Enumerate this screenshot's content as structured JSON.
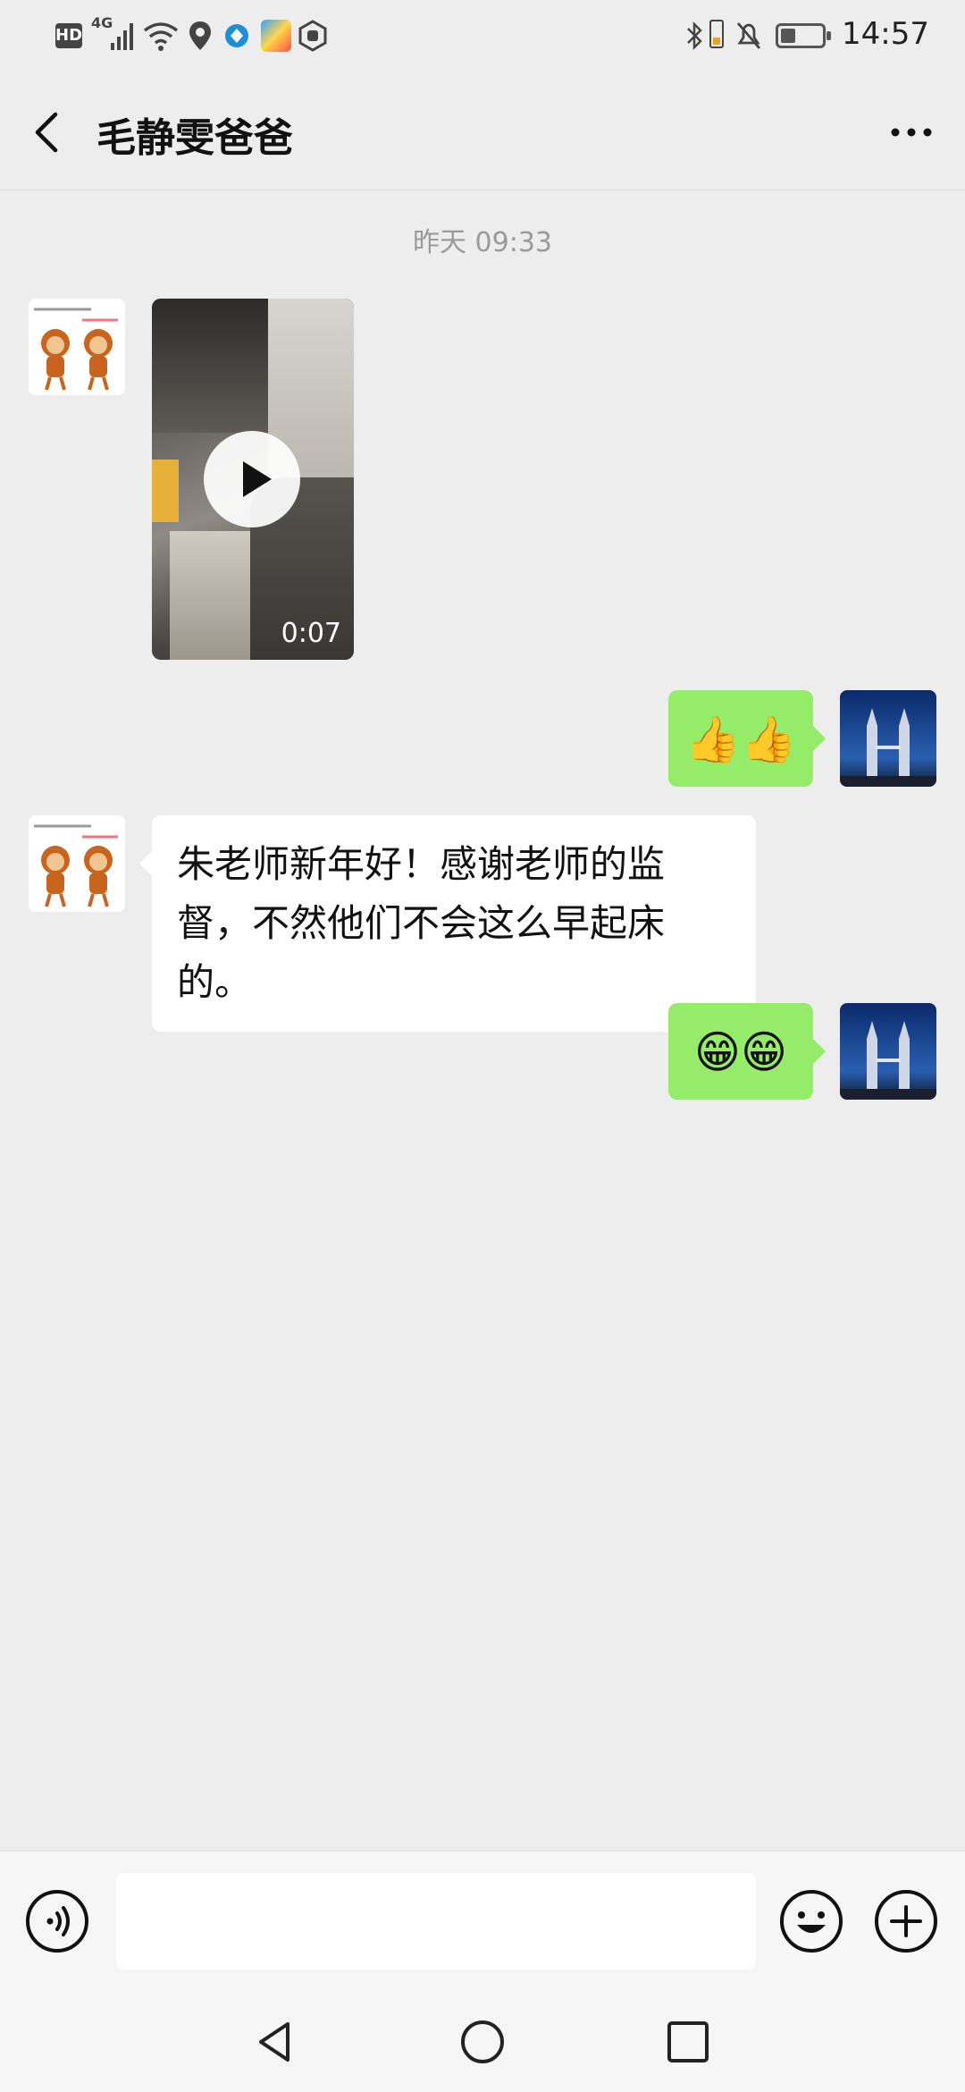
{
  "status_bar": {
    "time": "14:57",
    "hd_label": "HD",
    "network_label": "4G"
  },
  "header": {
    "back_icon": "chevron-left-icon",
    "title": "毛静雯爸爸",
    "more_icon": "more-dots-icon"
  },
  "chat": {
    "timestamp": "昨天 09:33",
    "messages": [
      {
        "side": "left",
        "type": "video",
        "duration": "0:07"
      },
      {
        "side": "right",
        "type": "emoji",
        "content": "👍👍"
      },
      {
        "side": "left",
        "type": "text",
        "content": "朱老师新年好！感谢老师的监督，不然他们不会这么早起床的。"
      },
      {
        "side": "right",
        "type": "emoji",
        "content": "😁😁"
      }
    ]
  },
  "input_bar": {
    "voice_icon": "voice-icon",
    "message_value": "",
    "emoji_icon": "emoji-icon",
    "plus_icon": "plus-icon"
  },
  "system_nav": {
    "back_icon": "nav-back-icon",
    "home_icon": "nav-home-icon",
    "recents_icon": "nav-recents-icon"
  },
  "colors": {
    "background": "#ededed",
    "sent_bubble": "#95ec69",
    "received_bubble": "#ffffff"
  }
}
